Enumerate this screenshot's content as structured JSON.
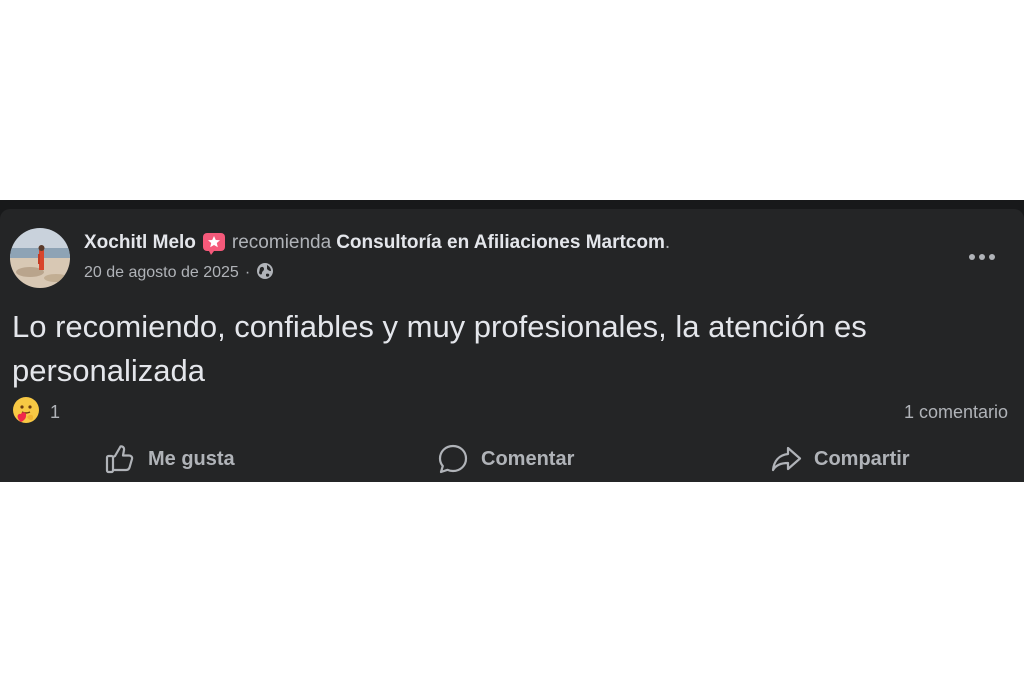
{
  "post": {
    "author": "Xochitl Melo",
    "action_text": "recomienda",
    "page_name": "Consultoría en Afiliaciones Martcom",
    "period": ".",
    "date": "20 de agosto de 2025",
    "separator": "·",
    "audience_icon": "globe-icon",
    "text": "Lo recomiendo, confiables y muy profesionales, la atención es personalizada"
  },
  "reactions": {
    "icon": "care-emoji-icon",
    "count": "1",
    "comments": "1 comentario"
  },
  "actions": {
    "like": "Me gusta",
    "comment": "Comentar",
    "share": "Compartir"
  },
  "colors": {
    "background": "#242526",
    "text_primary": "#e4e6eb",
    "text_secondary": "#b0b3b8",
    "badge": "#f5597a"
  }
}
